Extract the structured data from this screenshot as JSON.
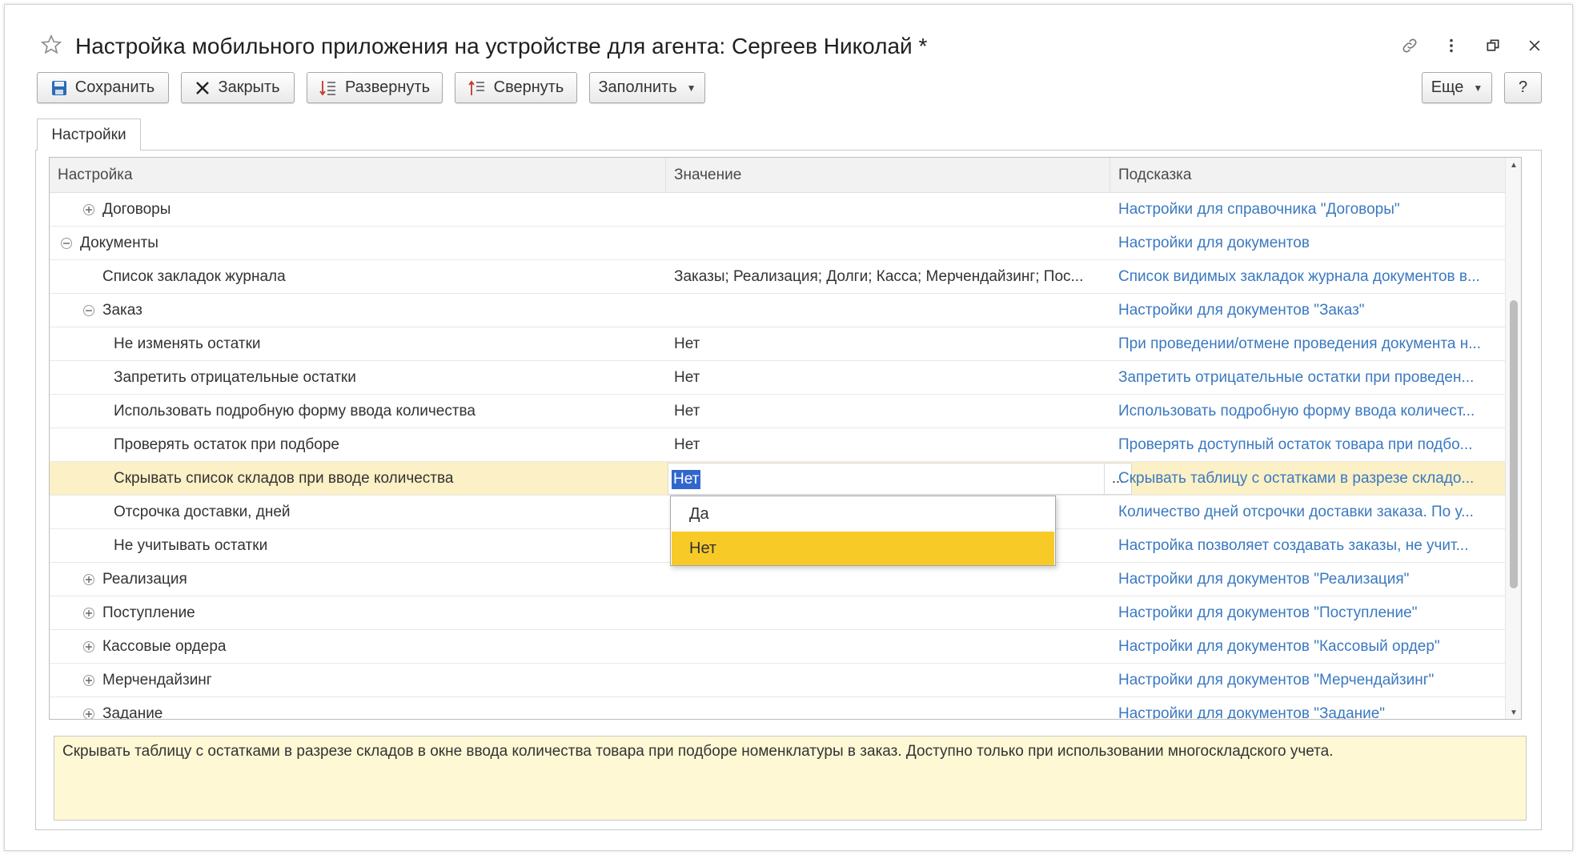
{
  "window": {
    "title": "Настройка мобильного приложения на устройстве для агента: Сергеев Николай *"
  },
  "toolbar": {
    "save_label": "Сохранить",
    "close_label": "Закрыть",
    "expand_label": "Развернуть",
    "collapse_label": "Свернуть",
    "fill_label": "Заполнить",
    "more_label": "Еще",
    "help_label": "?"
  },
  "tabs": [
    {
      "label": "Настройки"
    }
  ],
  "table": {
    "columns": [
      "Настройка",
      "Значение",
      "Подсказка"
    ],
    "rows": [
      {
        "name": "Договоры",
        "level": 1,
        "toggle": "plus",
        "value": "",
        "hint": "Настройки для справочника \"Договоры\""
      },
      {
        "name": "Документы",
        "level": 0,
        "toggle": "minus",
        "value": "",
        "hint": "Настройки для документов"
      },
      {
        "name": "Список закладок журнала",
        "level": 1,
        "toggle": "",
        "value": "Заказы; Реализация; Долги; Касса; Мерчендайзинг; Пос...",
        "hint": "Список видимых закладок журнала документов в..."
      },
      {
        "name": "Заказ",
        "level": 1,
        "toggle": "minus",
        "value": "",
        "hint": "Настройки для документов \"Заказ\""
      },
      {
        "name": "Не изменять остатки",
        "level": 2,
        "toggle": "",
        "value": "Нет",
        "hint": "При проведении/отмене проведения документа н..."
      },
      {
        "name": "Запретить отрицательные остатки",
        "level": 2,
        "toggle": "",
        "value": "Нет",
        "hint": "Запретить отрицательные остатки при проведен..."
      },
      {
        "name": "Использовать подробную форму ввода количества",
        "level": 2,
        "toggle": "",
        "value": "Нет",
        "hint": "Использовать подробную форму ввода количест..."
      },
      {
        "name": "Проверять остаток при подборе",
        "level": 2,
        "toggle": "",
        "value": "Нет",
        "hint": "Проверять доступный остаток товара при подбо..."
      },
      {
        "name": "Скрывать список складов при вводе количества",
        "level": 2,
        "toggle": "",
        "value": "Нет",
        "hint": "Скрывать таблицу с остатками в разрезе складо...",
        "selected": true
      },
      {
        "name": "Отсрочка доставки, дней",
        "level": 2,
        "toggle": "",
        "value": "",
        "hint": "Количество дней отсрочки доставки заказа. По у..."
      },
      {
        "name": "Не учитывать остатки",
        "level": 2,
        "toggle": "",
        "value": "",
        "hint": "Настройка позволяет создавать заказы, не учит..."
      },
      {
        "name": "Реализация",
        "level": 1,
        "toggle": "plus",
        "value": "",
        "hint": "Настройки для документов \"Реализация\""
      },
      {
        "name": "Поступление",
        "level": 1,
        "toggle": "plus",
        "value": "",
        "hint": "Настройки для документов \"Поступление\""
      },
      {
        "name": "Кассовые ордера",
        "level": 1,
        "toggle": "plus",
        "value": "",
        "hint": "Настройки для документов \"Кассовый ордер\""
      },
      {
        "name": "Мерчендайзинг",
        "level": 1,
        "toggle": "plus",
        "value": "",
        "hint": "Настройки для документов \"Мерчендайзинг\""
      },
      {
        "name": "Задание",
        "level": 1,
        "toggle": "plus",
        "value": "",
        "hint": "Настройки для документов \"Задание\""
      }
    ]
  },
  "editor": {
    "current_value": "Нет",
    "choose_button": "..."
  },
  "dropdown": {
    "options": [
      "Да",
      "Нет"
    ],
    "selected": "Нет"
  },
  "hint_panel": {
    "text": "Скрывать таблицу с остатками в разрезе складов в окне ввода количества товара при подборе номенклатуры в заказ. Доступно только при использовании многоскладского учета."
  },
  "colors": {
    "link": "#3b79c0",
    "selected_row": "#fbf0c6",
    "dropdown_highlight": "#f7ca27",
    "hint_background": "#fef8d5",
    "text_selection": "#3366cc"
  },
  "icons": [
    "star-icon",
    "link-icon",
    "more-vertical-icon",
    "restore-icon",
    "close-icon",
    "save-icon",
    "close-x-icon",
    "expand-icon",
    "collapse-icon",
    "plus-toggle-icon",
    "minus-toggle-icon"
  ]
}
